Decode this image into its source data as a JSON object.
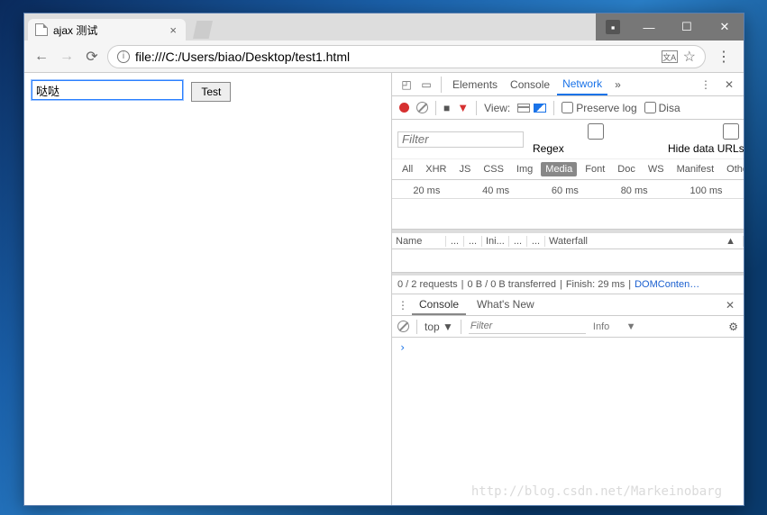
{
  "window": {
    "tab_title": "ajax 测试",
    "url_display": "file:///C:/Users/biao/Desktop/test1.html"
  },
  "page": {
    "input_value": "哒哒",
    "test_button_label": "Test"
  },
  "devtools": {
    "tabs": {
      "elements": "Elements",
      "console": "Console",
      "network": "Network"
    },
    "net_toolbar": {
      "view_label": "View:",
      "preserve_log": "Preserve log",
      "disable_cache": "Disa"
    },
    "filter": {
      "placeholder": "Filter",
      "regex": "Regex",
      "hide_data_urls": "Hide data URLs"
    },
    "types": [
      "All",
      "XHR",
      "JS",
      "CSS",
      "Img",
      "Media",
      "Font",
      "Doc",
      "WS",
      "Manifest",
      "Other"
    ],
    "active_type": "Media",
    "timeline_ticks": [
      "20 ms",
      "40 ms",
      "60 ms",
      "80 ms",
      "100 ms"
    ],
    "columns": {
      "name": "Name",
      "initiator": "Ini...",
      "waterfall": "Waterfall"
    },
    "status": {
      "requests": "0 / 2 requests",
      "transferred": "0 B / 0 B transferred",
      "finish": "Finish: 29 ms",
      "domcontent": "DOMConten…"
    },
    "drawer": {
      "console_tab": "Console",
      "whatsnew_tab": "What's New",
      "context": "top",
      "filter_placeholder": "Filter",
      "level": "Info",
      "prompt": "›"
    }
  },
  "watermark": "http://blog.csdn.net/Markeinobarg"
}
